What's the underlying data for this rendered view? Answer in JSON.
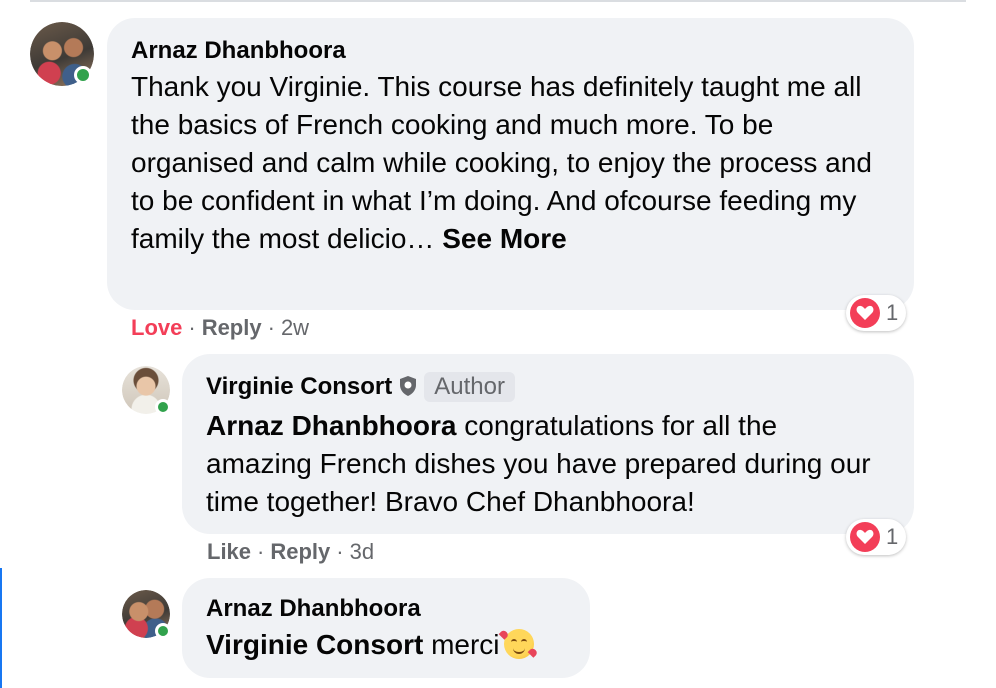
{
  "comments": [
    {
      "author": "Arnaz Dhanbhoora",
      "text_plain": "Thank you Virginie. This course has definitely taught me all the basics of French cooking and much more. To be organised and calm while cooking, to enjoy the process and to be confident in what I’m doing. And ofcourse feeding my family the most delicio… ",
      "see_more": "See More",
      "actions": {
        "love": "Love",
        "reply": "Reply",
        "time": "2w"
      },
      "reaction_count": "1"
    },
    {
      "author": "Virginie Consort",
      "badge": "Author",
      "mention": "Arnaz Dhanbhoora",
      "text_plain": " congratulations for all the amazing French dishes you have prepared during our time together! Bravo Chef Dhanbhoora!",
      "actions": {
        "like": "Like",
        "reply": "Reply",
        "time": "3d"
      },
      "reaction_count": "1"
    },
    {
      "author": "Arnaz Dhanbhoora",
      "mention": "Virginie Consort",
      "text_plain": " merci"
    }
  ],
  "colors": {
    "bubble": "#f0f2f5",
    "love": "#f33e58",
    "online": "#31a24c",
    "secondary_text": "#65676b",
    "thread_line": "#1877f2"
  },
  "icons": {
    "reaction": "heart-reaction-icon",
    "author_badge": "shield-icon",
    "emoji": "smiling-face-with-hearts-emoji"
  }
}
